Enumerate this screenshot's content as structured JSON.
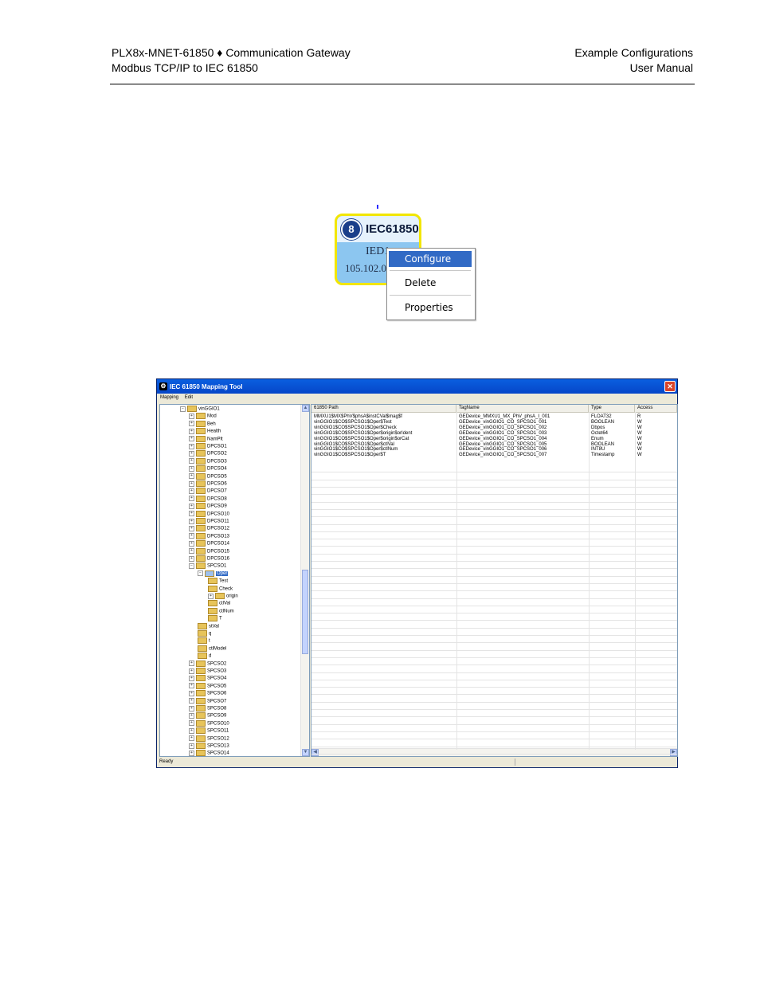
{
  "header": {
    "left_line1": "PLX8x-MNET-61850 ♦ Communication Gateway",
    "left_line2": "Modbus TCP/IP to IEC 61850",
    "right_line1": "Example Configurations",
    "right_line2": "User Manual"
  },
  "ied": {
    "badge": "8",
    "title": "IEC61850",
    "name": "IED1",
    "ip": "105.102.0.1"
  },
  "context_menu": {
    "items": [
      "Configure",
      "Delete",
      "Properties"
    ]
  },
  "window": {
    "title": "IEC 61850 Mapping Tool",
    "close": "✕",
    "menu": [
      "Mapping",
      "Edit"
    ],
    "status": "Ready",
    "tree": [
      {
        "label": "vinGGIO1",
        "level": 0,
        "expander": "−",
        "sel": false
      },
      {
        "label": "Mod",
        "level": 1,
        "expander": "+",
        "sel": false
      },
      {
        "label": "Beh",
        "level": 1,
        "expander": "+",
        "sel": false
      },
      {
        "label": "Health",
        "level": 1,
        "expander": "+",
        "sel": false
      },
      {
        "label": "NamPlt",
        "level": 1,
        "expander": "+",
        "sel": false
      },
      {
        "label": "DPCSO1",
        "level": 1,
        "expander": "+",
        "sel": false
      },
      {
        "label": "DPCSO2",
        "level": 1,
        "expander": "+",
        "sel": false
      },
      {
        "label": "DPCSO3",
        "level": 1,
        "expander": "+",
        "sel": false
      },
      {
        "label": "DPCSO4",
        "level": 1,
        "expander": "+",
        "sel": false
      },
      {
        "label": "DPCSO5",
        "level": 1,
        "expander": "+",
        "sel": false
      },
      {
        "label": "DPCSO6",
        "level": 1,
        "expander": "+",
        "sel": false
      },
      {
        "label": "DPCSO7",
        "level": 1,
        "expander": "+",
        "sel": false
      },
      {
        "label": "DPCSO8",
        "level": 1,
        "expander": "+",
        "sel": false
      },
      {
        "label": "DPCSO9",
        "level": 1,
        "expander": "+",
        "sel": false
      },
      {
        "label": "DPCSO10",
        "level": 1,
        "expander": "+",
        "sel": false
      },
      {
        "label": "DPCSO11",
        "level": 1,
        "expander": "+",
        "sel": false
      },
      {
        "label": "DPCSO12",
        "level": 1,
        "expander": "+",
        "sel": false
      },
      {
        "label": "DPCSO13",
        "level": 1,
        "expander": "+",
        "sel": false
      },
      {
        "label": "DPCSO14",
        "level": 1,
        "expander": "+",
        "sel": false
      },
      {
        "label": "DPCSO15",
        "level": 1,
        "expander": "+",
        "sel": false
      },
      {
        "label": "DPCSO16",
        "level": 1,
        "expander": "+",
        "sel": false
      },
      {
        "label": "SPCSO1",
        "level": 1,
        "expander": "−",
        "sel": false
      },
      {
        "label": "Oper",
        "level": 2,
        "expander": "−",
        "sel": true
      },
      {
        "label": "Test",
        "level": 3,
        "expander": "",
        "sel": false
      },
      {
        "label": "Check",
        "level": 3,
        "expander": "",
        "sel": false
      },
      {
        "label": "origin",
        "level": 3,
        "expander": "+",
        "sel": false
      },
      {
        "label": "ctlVal",
        "level": 3,
        "expander": "",
        "sel": false
      },
      {
        "label": "ctlNum",
        "level": 3,
        "expander": "",
        "sel": false
      },
      {
        "label": "T",
        "level": 3,
        "expander": "",
        "sel": false
      },
      {
        "label": "stVal",
        "level": 2,
        "expander": "",
        "sel": false
      },
      {
        "label": "q",
        "level": 2,
        "expander": "",
        "sel": false
      },
      {
        "label": "t",
        "level": 2,
        "expander": "",
        "sel": false
      },
      {
        "label": "ctlModel",
        "level": 2,
        "expander": "",
        "sel": false
      },
      {
        "label": "d",
        "level": 2,
        "expander": "",
        "sel": false
      },
      {
        "label": "SPCSO2",
        "level": 1,
        "expander": "+",
        "sel": false
      },
      {
        "label": "SPCSO3",
        "level": 1,
        "expander": "+",
        "sel": false
      },
      {
        "label": "SPCSO4",
        "level": 1,
        "expander": "+",
        "sel": false
      },
      {
        "label": "SPCSO5",
        "level": 1,
        "expander": "+",
        "sel": false
      },
      {
        "label": "SPCSO6",
        "level": 1,
        "expander": "+",
        "sel": false
      },
      {
        "label": "SPCSO7",
        "level": 1,
        "expander": "+",
        "sel": false
      },
      {
        "label": "SPCSO8",
        "level": 1,
        "expander": "+",
        "sel": false
      },
      {
        "label": "SPCSO9",
        "level": 1,
        "expander": "+",
        "sel": false
      },
      {
        "label": "SPCSO10",
        "level": 1,
        "expander": "+",
        "sel": false
      },
      {
        "label": "SPCSO11",
        "level": 1,
        "expander": "+",
        "sel": false
      },
      {
        "label": "SPCSO12",
        "level": 1,
        "expander": "+",
        "sel": false
      },
      {
        "label": "SPCSO13",
        "level": 1,
        "expander": "+",
        "sel": false
      },
      {
        "label": "SPCSO14",
        "level": 1,
        "expander": "+",
        "sel": false
      }
    ],
    "grid": {
      "columns": [
        "61850 Path",
        "TagName",
        "Type",
        "Access"
      ],
      "rows": [
        [
          "MMXU1$MX$PhV$phsA$instCVal$mag$f",
          "GEDevice_MMXU1_MX_PhV_phsA_I_001",
          "FLOAT32",
          "R"
        ],
        [
          "vinGGIO1$CO$SPCSO1$Oper$Test",
          "GEDevice_vinGGIO1_CO_SPCSO1_001",
          "BOOLEAN",
          "W"
        ],
        [
          "vinGGIO1$CO$SPCSO1$Oper$Check",
          "GEDevice_vinGGIO1_CO_SPCSO1_002",
          "Dbpos",
          "W"
        ],
        [
          "vinGGIO1$CO$SPCSO1$Oper$origin$orIdent",
          "GEDevice_vinGGIO1_CO_SPCSO1_003",
          "Octet64",
          "W"
        ],
        [
          "vinGGIO1$CO$SPCSO1$Oper$origin$orCat",
          "GEDevice_vinGGIO1_CO_SPCSO1_004",
          "Enum",
          "W"
        ],
        [
          "vinGGIO1$CO$SPCSO1$Oper$ctlVal",
          "GEDevice_vinGGIO1_CO_SPCSO1_005",
          "BOOLEAN",
          "W"
        ],
        [
          "vinGGIO1$CO$SPCSO1$Oper$ctlNum",
          "GEDevice_vinGGIO1_CO_SPCSO1_006",
          "INT8U",
          "W"
        ],
        [
          "vinGGIO1$CO$SPCSO1$Oper$T",
          "GEDevice_vinGGIO1_CO_SPCSO1_007",
          "Timestamp",
          "W"
        ]
      ]
    }
  }
}
